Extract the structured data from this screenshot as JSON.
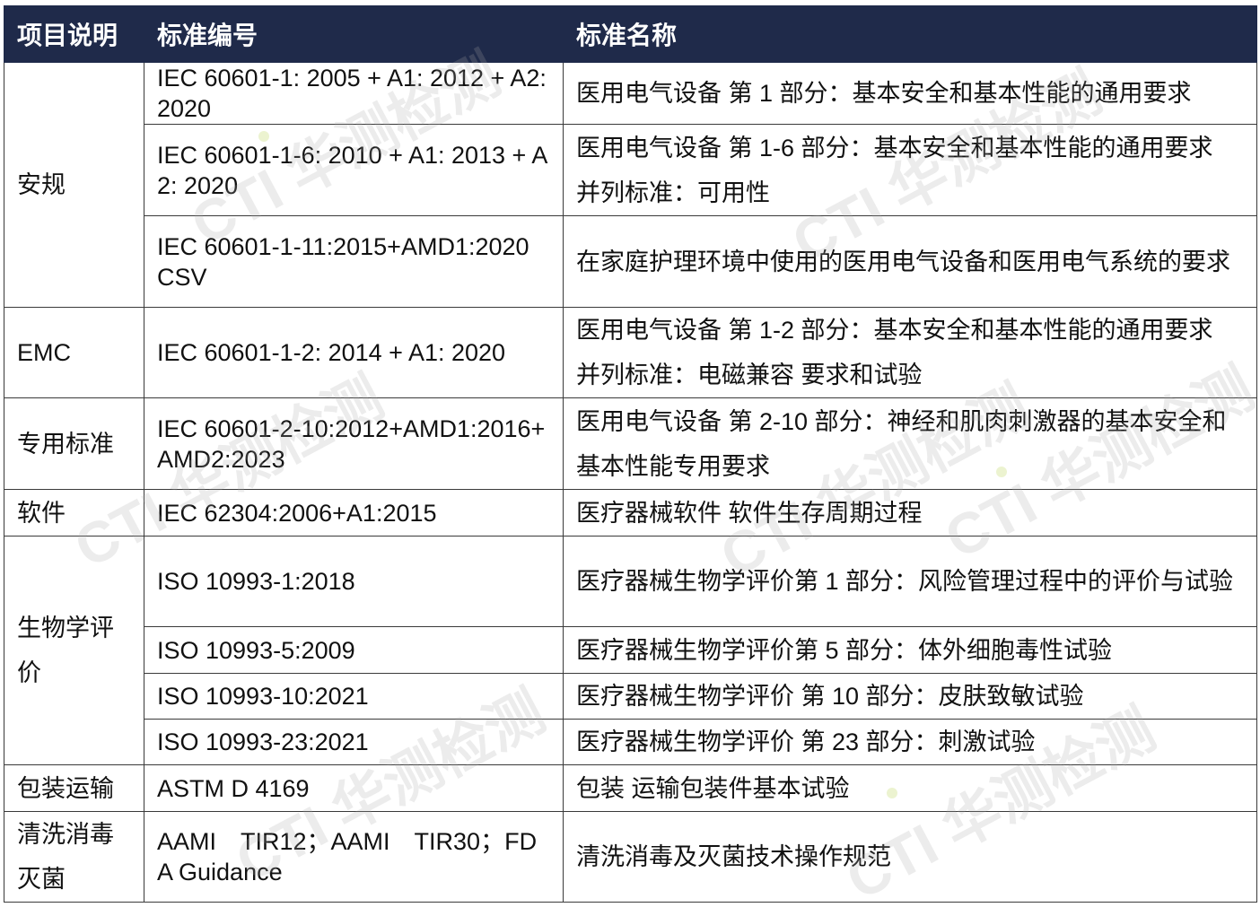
{
  "header": {
    "col1": "项目说明",
    "col2": "标准编号",
    "col3": "标准名称"
  },
  "rows": [
    {
      "category": "安规",
      "number": "IEC 60601-1: 2005 + A1: 2012 + A2: 2020",
      "name": "医用电气设备 第 1 部分：基本安全和基本性能的通用要求"
    },
    {
      "number": "IEC 60601-1-6: 2010 + A1: 2013 + A2: 2020",
      "name": "医用电气设备 第 1-6 部分：基本安全和基本性能的通用要求 并列标准：可用性"
    },
    {
      "number": "IEC 60601-1-11:2015+AMD1:2020 CSV",
      "name": "在家庭护理环境中使用的医用电气设备和医用电气系统的要求"
    },
    {
      "category": "EMC",
      "number": "IEC 60601-1-2: 2014 + A1: 2020",
      "name": "医用电气设备 第 1-2 部分：基本安全和基本性能的通用要求 并列标准：电磁兼容 要求和试验"
    },
    {
      "category": "专用标准",
      "number": "IEC 60601-2-10:2012+AMD1:2016+AMD2:2023",
      "name": "医用电气设备 第 2-10 部分：神经和肌肉刺激器的基本安全和基本性能专用要求"
    },
    {
      "category": "软件",
      "number": "IEC 62304:2006+A1:2015",
      "name": "医疗器械软件 软件生存周期过程"
    },
    {
      "category": "生物学评价",
      "number": "ISO 10993-1:2018",
      "name": "医疗器械生物学评价第 1 部分：风险管理过程中的评价与试验"
    },
    {
      "number": "ISO 10993-5:2009",
      "name": "医疗器械生物学评价第 5 部分：体外细胞毒性试验"
    },
    {
      "number": "ISO 10993-10:2021",
      "name": "医疗器械生物学评价 第 10 部分：皮肤致敏试验"
    },
    {
      "number": "ISO 10993-23:2021",
      "name": "医疗器械生物学评价 第 23 部分：刺激试验"
    },
    {
      "category": "包装运输",
      "number": "ASTM D 4169",
      "name": "包装 运输包装件基本试验"
    },
    {
      "category": "清洗消毒灭菌",
      "number": "AAMI　TIR12；AAMI　TIR30；FDA Guidance",
      "name": "清洗消毒及灭菌技术操作规范"
    }
  ],
  "watermark": {
    "text": "CTI 华测检测"
  }
}
